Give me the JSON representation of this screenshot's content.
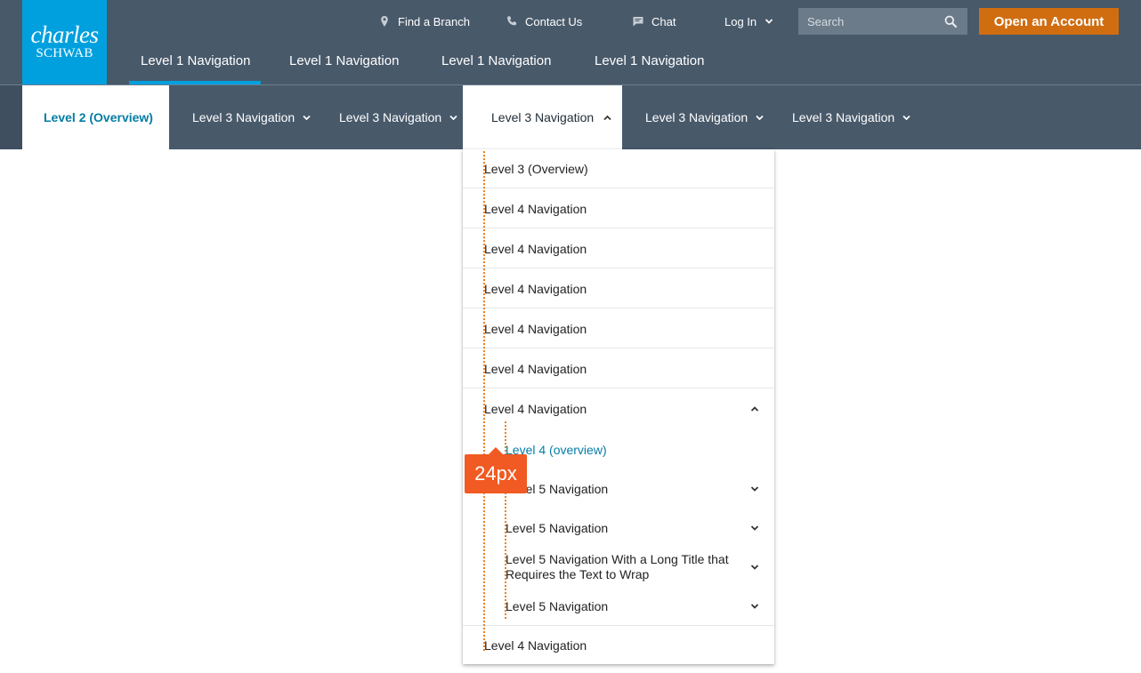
{
  "logo": {
    "line1": "charles",
    "line2": "SCHWAB"
  },
  "utility_nav": {
    "find_branch": "Find a Branch",
    "contact_us": "Contact Us",
    "chat": "Chat",
    "log_in": "Log In"
  },
  "search": {
    "placeholder": "Search"
  },
  "open_account": "Open an Account",
  "level1": [
    "Level 1 Navigation",
    "Level 1 Navigation",
    "Level 1 Navigation",
    "Level 1 Navigation"
  ],
  "level2": {
    "overview": "Level 2 (Overview)"
  },
  "level3": [
    "Level 3 Navigation",
    "Level 3 Navigation",
    "Level 3 Navigation",
    "Level 3 Navigation",
    "Level 3 Navigation"
  ],
  "dropdown": {
    "overview": "Level 3 (Overview)",
    "level4": [
      "Level 4 Navigation",
      "Level 4 Navigation",
      "Level 4 Navigation",
      "Level 4 Navigation",
      "Level 4 Navigation",
      "Level 4 Navigation"
    ],
    "level4_overview": "Level 4 (overview)",
    "level5": [
      "Level 5 Navigation",
      "Level 5 Navigation",
      "Level 5 Navigation With a Long Title that Requires the Text to Wrap",
      "Level 5 Navigation"
    ],
    "last_level4": "Level 4 Navigation"
  },
  "annotation": {
    "indent_label": "24px"
  },
  "colors": {
    "header_bg": "#48596a",
    "logo_bg": "#00a0df",
    "cta_orange": "#d06d11",
    "link_blue": "#037da6",
    "annotation_orange": "#f15a22"
  }
}
